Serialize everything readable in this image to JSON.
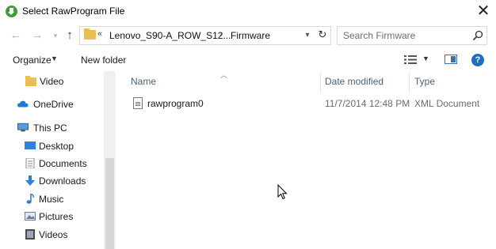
{
  "window": {
    "title": "Select RawProgram File",
    "close_label": "✕"
  },
  "address": {
    "overflow": "«",
    "path_1": "Lenovo_S90-A_ROW_S12...",
    "separator": "›",
    "path_2": "Firmware"
  },
  "search": {
    "placeholder": "Search Firmware"
  },
  "toolbar": {
    "organize_label": "Organize",
    "new_folder_label": "New folder",
    "help_label": "?"
  },
  "sidebar": {
    "items": [
      {
        "label": "Video",
        "icon": "folder-icon"
      },
      {
        "label": "OneDrive",
        "icon": "cloud-icon"
      },
      {
        "label": "This PC",
        "icon": "computer-icon"
      },
      {
        "label": "Desktop",
        "icon": "desktop-icon"
      },
      {
        "label": "Documents",
        "icon": "documents-icon"
      },
      {
        "label": "Downloads",
        "icon": "download-icon"
      },
      {
        "label": "Music",
        "icon": "music-icon"
      },
      {
        "label": "Pictures",
        "icon": "pictures-icon"
      },
      {
        "label": "Videos",
        "icon": "videos-icon"
      }
    ]
  },
  "columns": {
    "name": "Name",
    "date": "Date modified",
    "type": "Type"
  },
  "files": [
    {
      "name": "rawprogram0",
      "date": "11/7/2014 12:48 PM",
      "type": "XML Document"
    }
  ],
  "colors": {
    "folder": "#e8bf55",
    "accent": "#1b6ec2",
    "header_text": "#4c607a"
  }
}
